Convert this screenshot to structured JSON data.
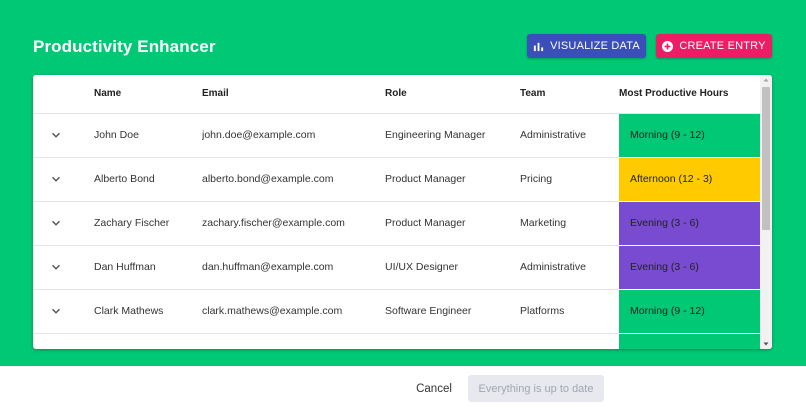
{
  "header": {
    "title": "Productivity Enhancer",
    "visualize_label": "VISUALIZE DATA",
    "create_label": "CREATE ENTRY"
  },
  "table": {
    "columns": [
      "",
      "Name",
      "Email",
      "Role",
      "Team",
      "Most Productive Hours"
    ],
    "rows": [
      {
        "name": "John Doe",
        "email": "john.doe@example.com",
        "role": "Engineering Manager",
        "team": "Administrative",
        "hours": "Morning (9 - 12)",
        "hours_color": "#00c875"
      },
      {
        "name": "Alberto Bond",
        "email": "alberto.bond@example.com",
        "role": "Product Manager",
        "team": "Pricing",
        "hours": "Afternoon (12 - 3)",
        "hours_color": "#ffcb00"
      },
      {
        "name": "Zachary Fischer",
        "email": "zachary.fischer@example.com",
        "role": "Product Manager",
        "team": "Marketing",
        "hours": "Evening (3 - 6)",
        "hours_color": "#784bd1"
      },
      {
        "name": "Dan Huffman",
        "email": "dan.huffman@example.com",
        "role": "UI/UX Designer",
        "team": "Administrative",
        "hours": "Evening (3 - 6)",
        "hours_color": "#784bd1"
      },
      {
        "name": "Clark Mathews",
        "email": "clark.mathews@example.com",
        "role": "Software Engineer",
        "team": "Platforms",
        "hours": "Morning (9 - 12)",
        "hours_color": "#00c875"
      },
      {
        "name": "",
        "email": "",
        "role": "",
        "team": "",
        "hours": "",
        "hours_color": "#00c875"
      }
    ]
  },
  "footer": {
    "cancel_label": "Cancel",
    "status_label": "Everything is up to date"
  },
  "colors": {
    "background": "#00c875",
    "visualize_button": "#3b4fb8",
    "create_button": "#ec1d64"
  },
  "icons": {
    "visualize": "bar-chart-icon",
    "create": "plus-circle-icon",
    "expand": "chevron-down-icon"
  }
}
